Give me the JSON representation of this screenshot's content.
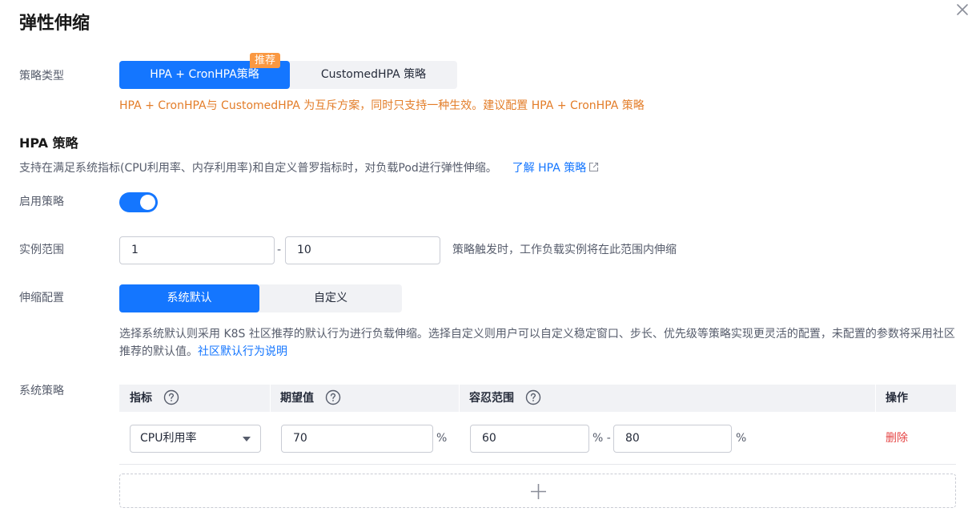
{
  "dialog": {
    "title": "弹性伸缩",
    "close_icon": "close-icon"
  },
  "policy_type": {
    "label": "策略类型",
    "options": [
      "HPA + CronHPA策略",
      "CustomedHPA 策略"
    ],
    "selected": "HPA + CronHPA策略",
    "badge": "推荐",
    "warning": "HPA + CronHPA与 CustomedHPA 为互斥方案，同时只支持一种生效。建议配置 HPA + CronHPA 策略"
  },
  "hpa": {
    "title": "HPA 策略",
    "desc": "支持在满足系统指标(CPU利用率、内存利用率)和自定义普罗指标时，对负载Pod进行弹性伸缩。",
    "link": "了解 HPA 策略",
    "enable_label": "启用策略",
    "enabled": true,
    "range": {
      "label": "实例范围",
      "min": "1",
      "separator": "-",
      "max": "10",
      "hint": "策略触发时，工作负载实例将在此范围内伸缩"
    },
    "scaling": {
      "label": "伸缩配置",
      "options": [
        "系统默认",
        "自定义"
      ],
      "selected": "系统默认",
      "desc": "选择系统默认则采用 K8S 社区推荐的默认行为进行负载伸缩。选择自定义则用户可以自定义稳定窗口、步长、优先级等策略实现更灵活的配置，未配置的参数将采用社区推荐的默认值。",
      "link": "社区默认行为说明"
    },
    "system_policy": {
      "label": "系统策略",
      "columns": [
        "指标",
        "期望值",
        "容忍范围",
        "操作"
      ],
      "rows": [
        {
          "metric": "CPU利用率",
          "expected": "70",
          "expected_unit": "%",
          "tolerance_min": "60",
          "tolerance_sep": "% -",
          "tolerance_max": "80",
          "tolerance_unit": "%",
          "action": "删除"
        }
      ]
    }
  },
  "colors": {
    "primary": "#1476ff",
    "warning": "#e37d29",
    "badge": "#fa9841",
    "danger": "#e54545"
  }
}
